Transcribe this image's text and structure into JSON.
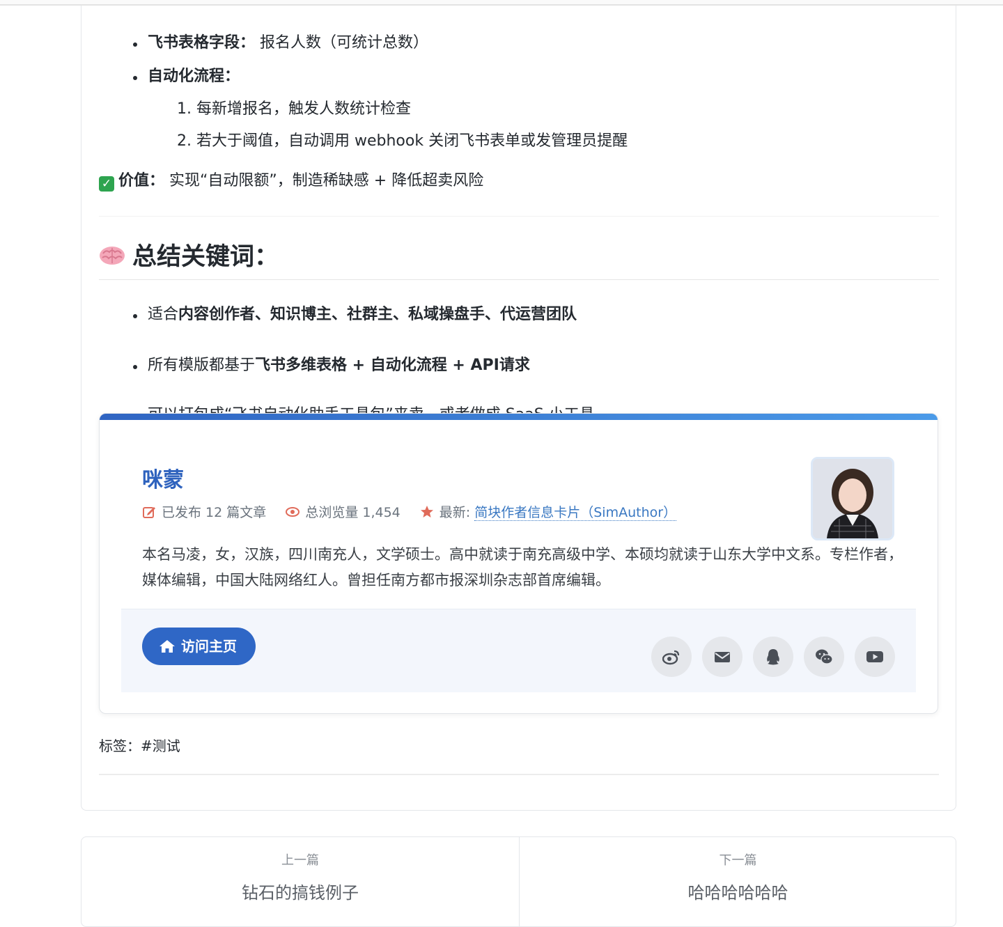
{
  "intro_bullets": [
    {
      "bold": "飞书表格字段：",
      "text": " 报名人数（可统计总数）"
    },
    {
      "bold": "自动化流程：",
      "text": ""
    }
  ],
  "steps": [
    "1. 每新增报名，触发人数统计检查",
    "2. 若大于阈值，自动调用 webhook 关闭飞书表单或发管理员提醒"
  ],
  "value": {
    "icon": "check-mark-icon",
    "bold": "价值：",
    "text": " 实现“自动限额”，制造稀缺感 + 降低超卖风险"
  },
  "summary": {
    "icon": "brain-icon",
    "heading": "总结关键词：",
    "items": [
      {
        "prefix": "适合",
        "bold": "内容创作者、知识博主、社群主、私域操盘手、代运营团队",
        "suffix": ""
      },
      {
        "prefix": "所有模版都基于",
        "bold": "飞书多维表格 + 自动化流程 + API请求",
        "suffix": ""
      },
      {
        "prefix": "可以打包成“飞书自动化助手工具包”来卖，或者做成 SaaS 小工具",
        "bold": "",
        "suffix": ""
      }
    ]
  },
  "author_card": {
    "name": "咪蒙",
    "meta": {
      "articles": "已发布 12 篇文章",
      "views": "总浏览量 1,454",
      "latest_label": "最新:",
      "latest_link": "简块作者信息卡片（SimAuthor）"
    },
    "bio": "本名马凌，女，汉族，四川南充人，文学硕士。高中就读于南充高级中学、本硕均就读于山东大学中文系。专栏作者，媒体编辑，中国大陆网络红人。曾担任南方都市报深圳杂志部首席编辑。",
    "visit_button": "访问主页",
    "social_icons": [
      "weibo-icon",
      "mail-icon",
      "qq-icon",
      "wechat-icon",
      "youtube-icon"
    ],
    "accent_color": "#2f67c6"
  },
  "tags": {
    "label": "标签：",
    "value": "#测试"
  },
  "nav": {
    "prev_label": "上一篇",
    "prev_title": "钻石的搞钱例子",
    "next_label": "下一篇",
    "next_title": "哈哈哈哈哈哈"
  }
}
